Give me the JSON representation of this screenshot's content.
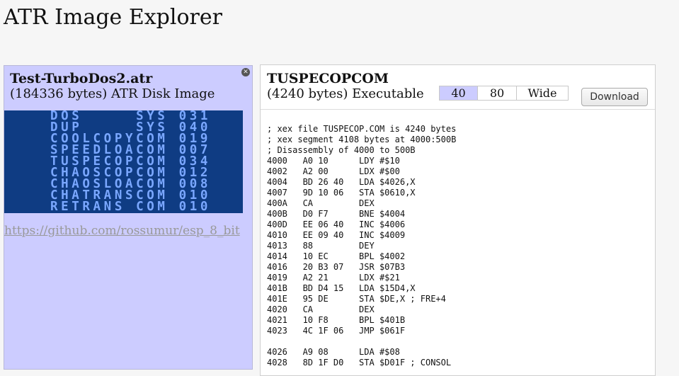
{
  "app": {
    "title": "ATR Image Explorer"
  },
  "disk": {
    "name": "Test-TurboDos2.atr",
    "size_line": "(184336 bytes) ATR Disk Image",
    "directory": [
      "DOS     SYS 031",
      "DUP     SYS 040",
      "COOLCOPYCOM 019",
      "SPEEDLOACOM 007",
      "TUSPECOPCOM 034",
      "CHAOSCOPCOM 012",
      "CHAOSLOACOM 008",
      "CHATRANSCOM 010",
      "RETRANS COM 010"
    ],
    "repo_link": "https://github.com/rossumur/esp_8_bit"
  },
  "file": {
    "name": "TUSPECOPCOM",
    "size_line": "(4240 bytes) Executable",
    "width_options": [
      "40",
      "80",
      "Wide"
    ],
    "selected_width": "40",
    "download_label": "Download",
    "listing": "; xex file TUSPECOP.COM is 4240 bytes\n; xex segment 4108 bytes at 4000:500B\n; Disassembly of 4000 to 500B\n4000   A0 10      LDY #$10\n4002   A2 00      LDX #$00\n4004   BD 26 40   LDA $4026,X\n4007   9D 10 06   STA $0610,X\n400A   CA         DEX\n400B   D0 F7      BNE $4004\n400D   EE 06 40   INC $4006\n4010   EE 09 40   INC $4009\n4013   88         DEY\n4014   10 EC      BPL $4002\n4016   20 B3 07   JSR $07B3\n4019   A2 21      LDX #$21\n401B   BD D4 15   LDA $15D4,X\n401E   95 DE      STA $DE,X ; FRE+4\n4020   CA         DEX\n4021   10 F8      BPL $401B\n4023   4C 1F 06   JMP $061F\n\n4026   A9 08      LDA #$08\n4028   8D 1F D0   STA $D01F ; CONSOL"
  },
  "colors": {
    "panel_bg": "#ccccff",
    "screen_bg": "#0f3c83",
    "screen_text": "#7aa7ff",
    "active_toggle": "#ccccff"
  },
  "icons": {
    "close": "close-icon"
  }
}
